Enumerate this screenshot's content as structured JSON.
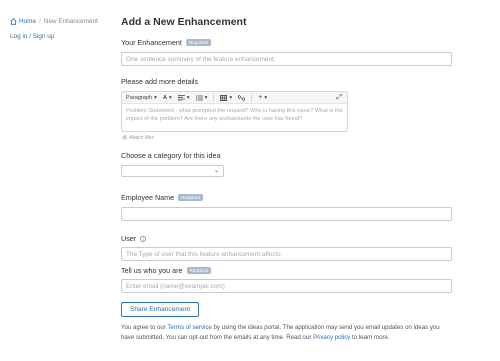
{
  "sidebar": {
    "breadcrumb_home": "Home",
    "breadcrumb_separator": "/",
    "breadcrumb_current": "New Enhancement",
    "login_link": "Log in / Sign up"
  },
  "page": {
    "title": "Add a New Enhancement"
  },
  "form": {
    "enhancement": {
      "label": "Your Enhancement",
      "badge": "Required",
      "placeholder": "One sentence summary of the feature enhancement."
    },
    "details": {
      "label": "Please add more details",
      "toolbar": {
        "paragraph": "Paragraph",
        "font": "A",
        "expand": "⤢"
      },
      "placeholder": "Problem Statement - what prompted the request? Who is having this issue? What is the impact of the problem?  Are there any workarounds the user has found?",
      "attach": "Attach files"
    },
    "category": {
      "label": "Choose a category for this idea",
      "value": ""
    },
    "employee": {
      "label": "Employee Name",
      "badge": "Required"
    },
    "user": {
      "label": "User",
      "placeholder": "The Type of user that this feature enhancement affects"
    },
    "email": {
      "label": "Tell us who you are",
      "badge": "Required",
      "placeholder": "Enter email (name@example.com)"
    },
    "submit_label": "Share Enhancement"
  },
  "footer": {
    "text1": "You agree to our ",
    "terms": "Terms of service",
    "text2": " by using the ideas portal. The application may send you email updates on ideas you have submitted. You can opt-out from the emails at any time. Read our ",
    "privacy": "Privacy policy",
    "text3": " to learn more."
  },
  "colors": {
    "accent": "#2a6fb8",
    "required_badge": "#a9b9cc"
  }
}
